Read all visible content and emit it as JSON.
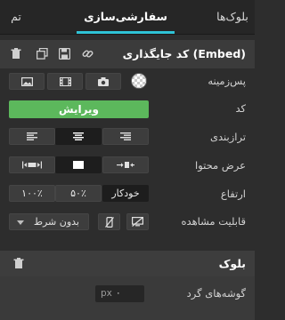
{
  "tabs": [
    {
      "label": "تم"
    },
    {
      "label": "سفارشی‌سازی",
      "active": true
    },
    {
      "label": "بلوک‌ها"
    }
  ],
  "embed_section": {
    "title": "کد جایگذاری (Embed)"
  },
  "background": {
    "label": "پس‌زمینه",
    "icons": [
      "image-icon",
      "video-icon",
      "camera-icon",
      "transparent-color-icon"
    ]
  },
  "code": {
    "label": "کد",
    "button": "ویرایش"
  },
  "alignment": {
    "label": "ترازبندی",
    "options": [
      "align-left-icon",
      "align-center-icon",
      "align-right-icon"
    ],
    "selected": "align-center-icon"
  },
  "content_width": {
    "label": "عرض محتوا",
    "options": [
      "expand-width-icon",
      "box-width-icon",
      "shrink-width-icon"
    ],
    "selected": "box-width-icon"
  },
  "height": {
    "label": "ارتفاع",
    "options": [
      "۱۰۰٪",
      "۵۰٪",
      "خودکار"
    ],
    "selected": "خودکار"
  },
  "visibility": {
    "label": "قابلیت مشاهده",
    "dropdown_value": "بدون شرط"
  },
  "block_section": {
    "title": "بلوک"
  },
  "corner_radius": {
    "label": "گوشه‌های گرد",
    "unit": "px",
    "value": "۰"
  },
  "colors": {
    "accent": "#2fc3d6",
    "edit_button": "#5cb85c",
    "panel": "#2d2d2d"
  }
}
